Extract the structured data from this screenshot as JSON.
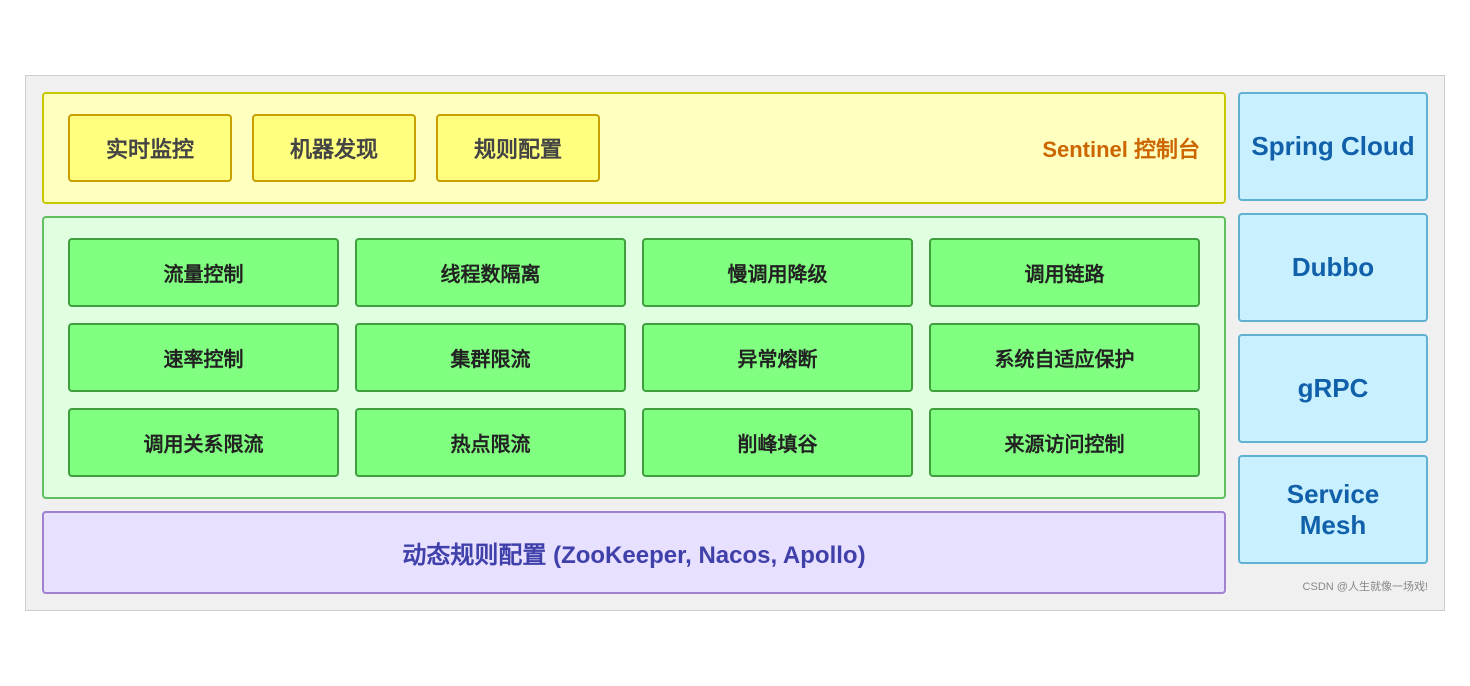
{
  "sentinel": {
    "box1": "实时监控",
    "box2": "机器发现",
    "box3": "规则配置",
    "label": "Sentinel 控制台"
  },
  "features": {
    "row1": [
      "流量控制",
      "线程数隔离",
      "慢调用降级",
      "调用链路"
    ],
    "row2": [
      "速率控制",
      "集群限流",
      "异常熔断",
      "系统自适应保护"
    ],
    "row3": [
      "调用关系限流",
      "热点限流",
      "削峰填谷",
      "来源访问控制"
    ]
  },
  "dynamic": {
    "label": "动态规则配置 (ZooKeeper, Nacos, Apollo)"
  },
  "right": {
    "items": [
      "Spring Cloud",
      "Dubbo",
      "gRPC",
      "Service Mesh"
    ]
  },
  "watermark": "CSDN @人生就像一场戏!"
}
